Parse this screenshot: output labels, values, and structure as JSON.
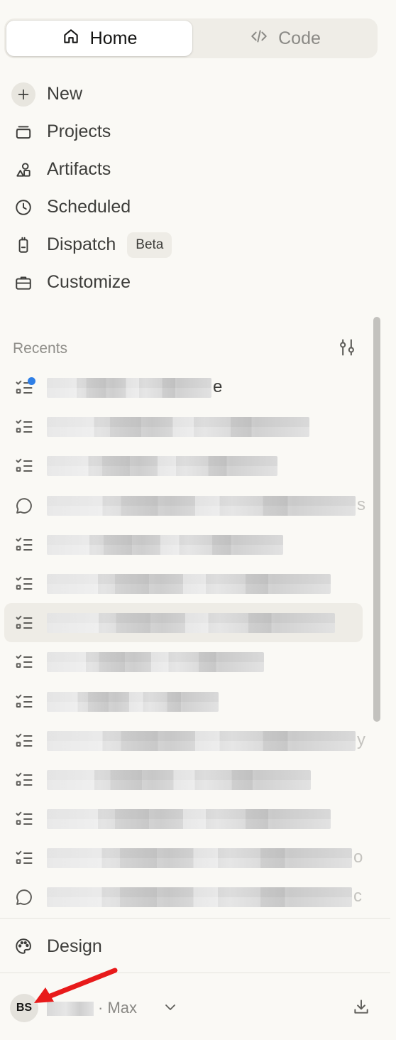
{
  "tabs": {
    "home_label": "Home",
    "code_label": "Code"
  },
  "nav": {
    "new_label": "New",
    "projects_label": "Projects",
    "artifacts_label": "Artifacts",
    "scheduled_label": "Scheduled",
    "dispatch_label": "Dispatch",
    "dispatch_badge": "Beta",
    "customize_label": "Customize"
  },
  "recents": {
    "title": "Recents",
    "items": [
      {
        "icon": "task-list-icon",
        "tail": "e",
        "unread": true
      },
      {
        "icon": "task-list-icon"
      },
      {
        "icon": "task-list-icon"
      },
      {
        "icon": "chat-bubble-icon",
        "tail": "s"
      },
      {
        "icon": "task-list-icon"
      },
      {
        "icon": "task-list-icon"
      },
      {
        "icon": "task-list-icon",
        "selected": true
      },
      {
        "icon": "task-list-icon"
      },
      {
        "icon": "task-list-icon"
      },
      {
        "icon": "task-list-icon",
        "tail": "y"
      },
      {
        "icon": "task-list-icon"
      },
      {
        "icon": "task-list-icon"
      },
      {
        "icon": "task-list-icon",
        "tail": "o"
      },
      {
        "icon": "chat-bubble-icon",
        "tail": "c"
      }
    ]
  },
  "design_label": "Design",
  "footer": {
    "avatar_initials": "BS",
    "plan_label": "· Max"
  },
  "colors": {
    "background": "#faf9f5",
    "accent_dot": "#2f7fe6",
    "annotation_arrow": "#e81a1a"
  }
}
